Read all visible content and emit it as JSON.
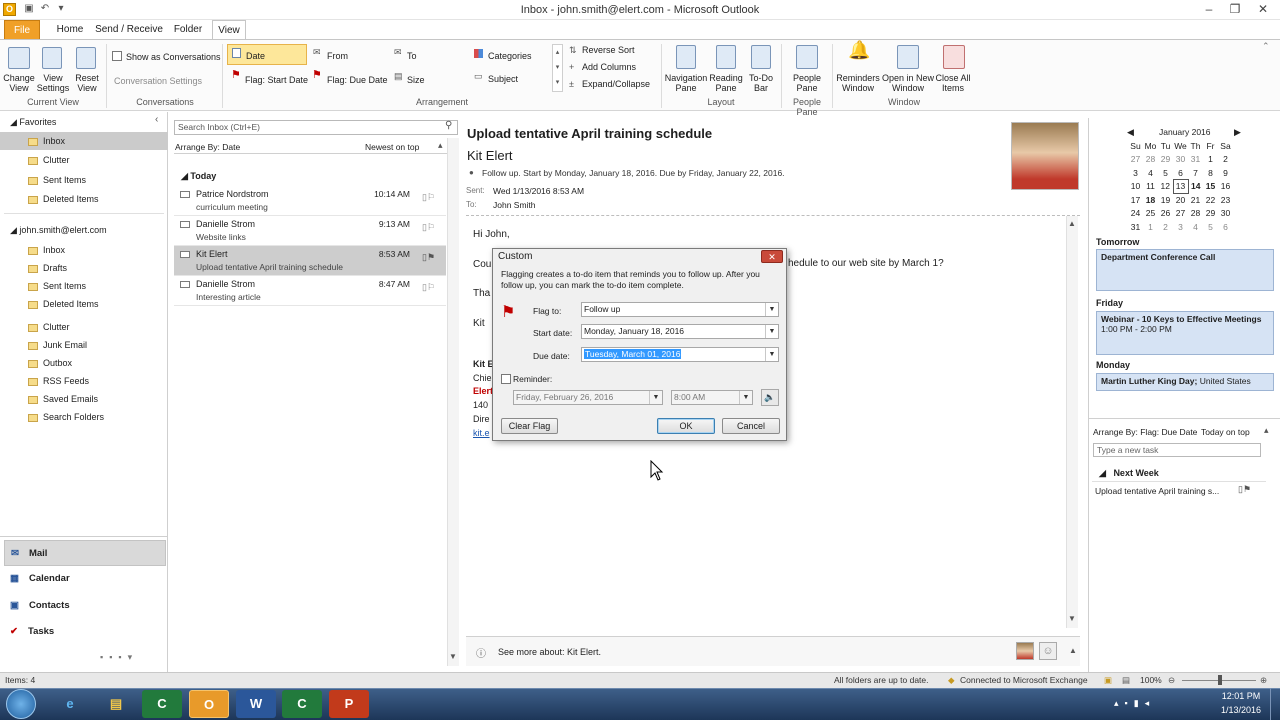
{
  "window": {
    "title": "Inbox - john.smith@elert.com - Microsoft Outlook",
    "app_icon": "O"
  },
  "tabs": [
    {
      "label": "File"
    },
    {
      "label": "Home"
    },
    {
      "label": "Send / Receive"
    },
    {
      "label": "Folder"
    },
    {
      "label": "View"
    }
  ],
  "ribbon": {
    "change_view": "Change View",
    "view_settings": "View Settings",
    "reset_view": "Reset View",
    "group_current_view": "Current View",
    "show_as_conversations": "Show as Conversations",
    "conversation_settings": "Conversation Settings",
    "group_conversations": "Conversations",
    "arr_date": "Date",
    "arr_from": "From",
    "arr_to": "To",
    "arr_categories": "Categories",
    "arr_flag_start": "Flag: Start Date",
    "arr_flag_due": "Flag: Due Date",
    "arr_size": "Size",
    "arr_subject": "Subject",
    "reverse_sort": "Reverse Sort",
    "add_columns": "Add Columns",
    "expand_collapse": "Expand/Collapse",
    "group_arrangement": "Arrangement",
    "navigation_pane": "Navigation Pane",
    "reading_pane": "Reading Pane",
    "todo_bar": "To-Do Bar",
    "group_layout": "Layout",
    "people_pane": "People Pane",
    "group_people_pane": "People Pane",
    "reminders_window": "Reminders Window",
    "open_new_window": "Open in New Window",
    "close_all_items": "Close All Items",
    "group_window": "Window"
  },
  "nav": {
    "favorites_header": "Favorites",
    "favorites": [
      "Inbox",
      "Clutter",
      "Sent Items",
      "Deleted Items"
    ],
    "account": "john.smith@elert.com",
    "folders": [
      "Inbox",
      "Drafts",
      "Sent Items",
      "Deleted Items",
      "Clutter",
      "Junk Email",
      "Outbox",
      "RSS Feeds",
      "Saved Emails",
      "Search Folders"
    ],
    "bottom": [
      "Mail",
      "Calendar",
      "Contacts",
      "Tasks"
    ]
  },
  "list": {
    "search_placeholder": "Search Inbox (Ctrl+E)",
    "arrange_by": "Arrange By: Date",
    "sort_order": "Newest on top",
    "group_today": "Today",
    "messages": [
      {
        "sender": "Patrice Nordstrom",
        "subject": "curriculum meeting",
        "time": "10:14 AM"
      },
      {
        "sender": "Danielle Strom",
        "subject": "Website links",
        "time": "9:13 AM"
      },
      {
        "sender": "Kit Elert",
        "subject": "Upload tentative April training schedule",
        "time": "8:53 AM"
      },
      {
        "sender": "Danielle Strom",
        "subject": "Interesting article",
        "time": "8:47 AM"
      }
    ]
  },
  "reading": {
    "subject": "Upload tentative April training schedule",
    "sender": "Kit Elert",
    "followup": "Follow up.  Start by Monday, January 18, 2016.  Due by Friday, January 22, 2016.",
    "sent_label": "Sent:",
    "sent_value": "Wed 1/13/2016 8:53 AM",
    "to_label": "To:",
    "to_value": "John Smith",
    "greeting": "Hi John,",
    "body_line1_start": "Cou",
    "body_line1_end": "hedule to our web site by March 1?",
    "thanks": "Tha",
    "sig_kit": "Kit",
    "sig1": "Kit E",
    "sig2": "Chie",
    "sig3": "Elert",
    "sig4": "140",
    "sig5": "Dire",
    "sig6": "kit.e",
    "people_footer": "See more about: Kit Elert."
  },
  "dialog": {
    "title": "Custom",
    "desc": "Flagging creates a to-do item that reminds you to follow up. After you follow up, you can mark the to-do item complete.",
    "flag_to_label": "Flag to:",
    "flag_to_value": "Follow up",
    "start_label": "Start date:",
    "start_value": "Monday, January 18, 2016",
    "due_label": "Due date:",
    "due_value": "Tuesday, March 01, 2016",
    "reminder_label": "Reminder:",
    "reminder_date": "Friday, February 26, 2016",
    "reminder_time": "8:00 AM",
    "clear_flag": "Clear Flag",
    "ok": "OK",
    "cancel": "Cancel"
  },
  "todo": {
    "month": "January 2016",
    "weekdays": [
      "Su",
      "Mo",
      "Tu",
      "We",
      "Th",
      "Fr",
      "Sa"
    ],
    "tomorrow_label": "Tomorrow",
    "tomorrow_appt": "Department Conference Call",
    "friday_label": "Friday",
    "friday_appt": "Webinar - 10 Keys to Effective Meetings",
    "friday_time": "1:00 PM - 2:00 PM",
    "monday_label": "Monday",
    "monday_appt_bold": "Martin Luther King Day;",
    "monday_appt_rest": " United States",
    "task_arrange": "Arrange By: Flag: Due Date",
    "task_sort": "Today on top",
    "new_task_placeholder": "Type a new task",
    "next_week": "Next Week",
    "task_item": "Upload tentative April training s..."
  },
  "status": {
    "items": "Items: 4",
    "sync": "All folders are up to date.",
    "connection": "Connected to Microsoft Exchange",
    "zoom": "100%"
  },
  "taskbar": {
    "time": "12:01 PM",
    "date": "1/13/2016"
  },
  "colors": {
    "file_tab": "#f0a028",
    "accent_blue": "#2a5699",
    "flag_red": "#c00000"
  }
}
